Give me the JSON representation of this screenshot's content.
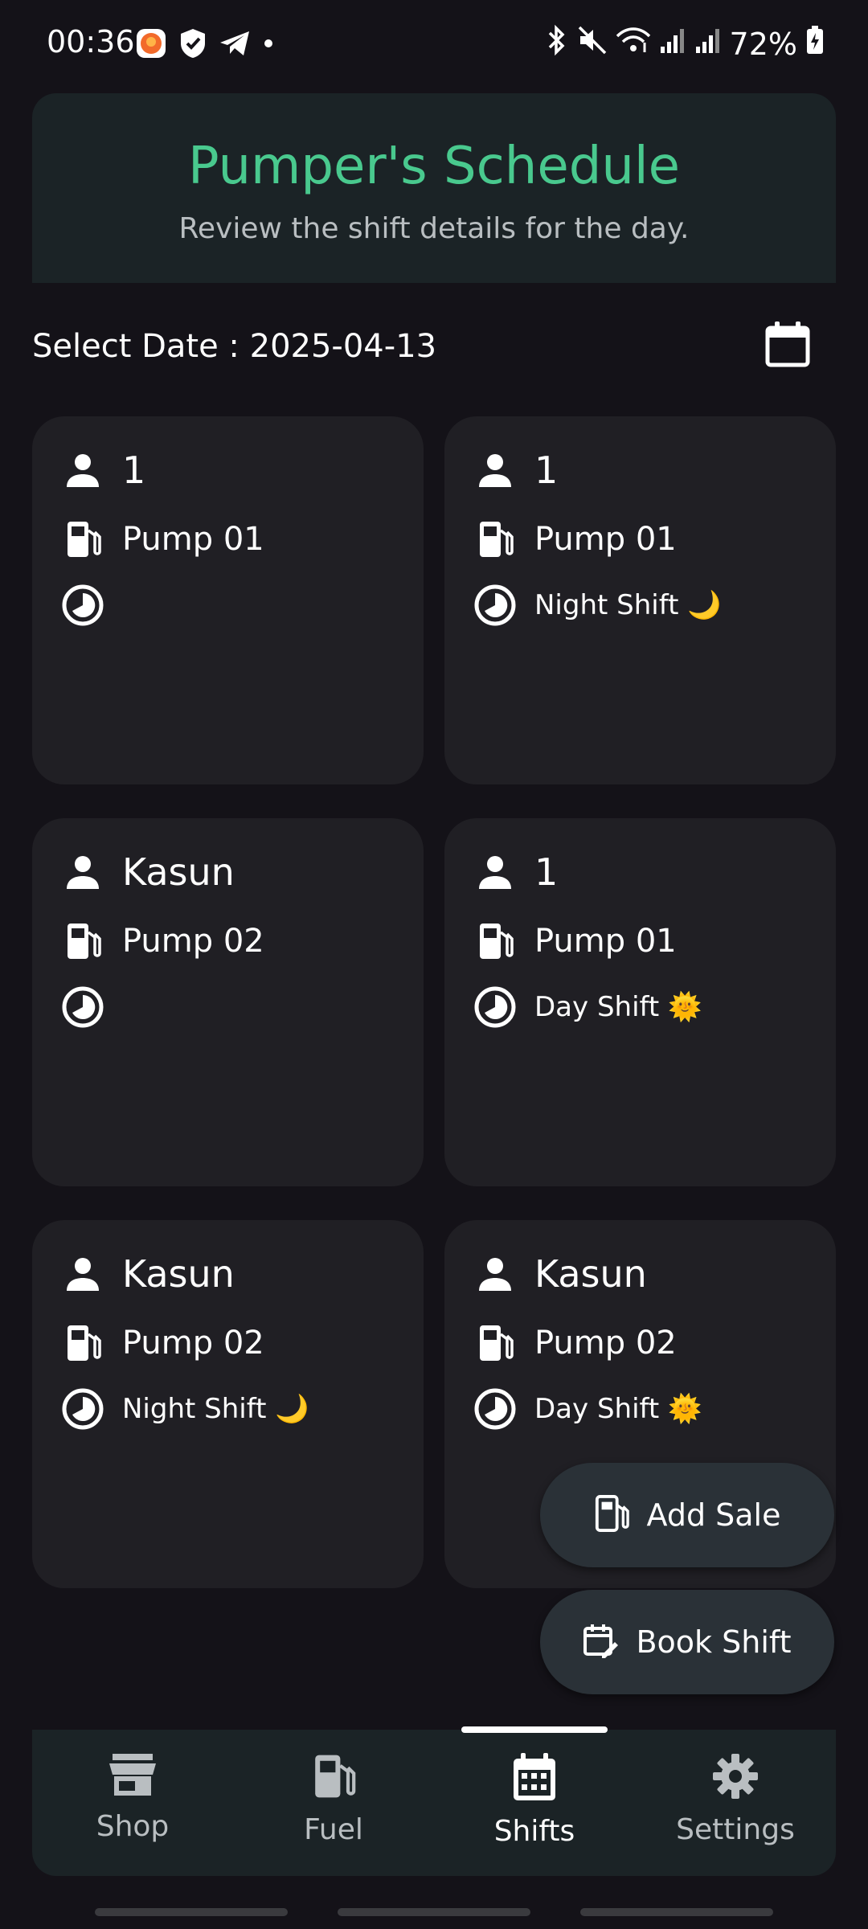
{
  "status_bar": {
    "time": "00:36",
    "battery": "72%"
  },
  "header": {
    "title": "Pumper's Schedule",
    "subtitle": "Review the shift details for the day."
  },
  "date": {
    "label": "Select Date : 2025-04-13"
  },
  "cards": [
    {
      "name": "1",
      "pump": "Pump 01",
      "shift": ""
    },
    {
      "name": "1",
      "pump": "Pump 01",
      "shift": "Night Shift 🌙"
    },
    {
      "name": "Kasun",
      "pump": "Pump 02",
      "shift": ""
    },
    {
      "name": "1",
      "pump": "Pump 01",
      "shift": "Day Shift 🌞"
    },
    {
      "name": "Kasun",
      "pump": "Pump 02",
      "shift": "Night Shift 🌙"
    },
    {
      "name": "Kasun",
      "pump": "Pump 02",
      "shift": "Day Shift 🌞"
    }
  ],
  "fabs": {
    "add_sale": "Add Sale",
    "book_shift": "Book Shift"
  },
  "nav": {
    "items": [
      {
        "label": "Shop",
        "icon": "store-icon"
      },
      {
        "label": "Fuel",
        "icon": "fuel-pump-icon"
      },
      {
        "label": "Shifts",
        "icon": "calendar-icon",
        "active": true
      },
      {
        "label": "Settings",
        "icon": "gear-icon"
      }
    ]
  },
  "colors": {
    "background": "#141218",
    "accent": "#49c98e",
    "card": "#201f24",
    "header_bg": "#1b2326",
    "fab_bg": "#2a3137"
  }
}
